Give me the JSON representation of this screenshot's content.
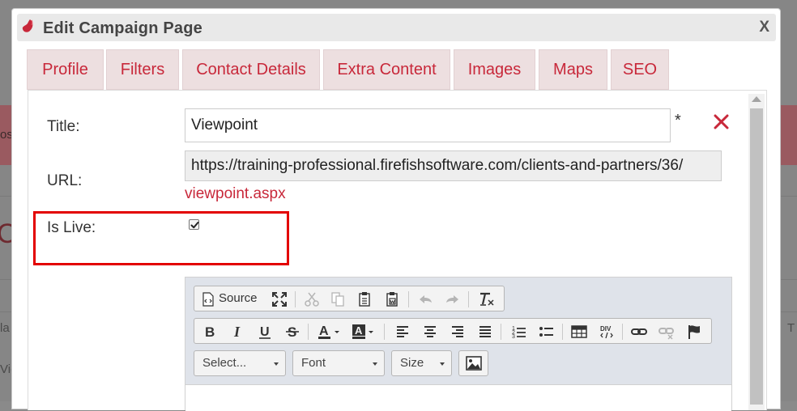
{
  "backdrop": {
    "fragment_left_1": "os",
    "fragment_left_2": "C",
    "fragment_left_3": "la",
    "fragment_left_4": "Vie",
    "fragment_right": "T"
  },
  "dialog": {
    "title": "Edit Campaign Page",
    "close_label": "X"
  },
  "tabs": [
    {
      "label": "Profile"
    },
    {
      "label": "Filters"
    },
    {
      "label": "Contact Details"
    },
    {
      "label": "Extra Content"
    },
    {
      "label": "Images"
    },
    {
      "label": "Maps"
    },
    {
      "label": "SEO"
    }
  ],
  "form": {
    "title_label": "Title:",
    "title_value": "Viewpoint",
    "required_marker": "*",
    "url_label": "URL:",
    "url_value": "https://training-professional.firefishsoftware.com/clients-and-partners/36/",
    "url_link": "viewpoint.aspx",
    "is_live_label": "Is Live:",
    "is_live_checked": true
  },
  "editor": {
    "source_label": "Source",
    "format_select": "Select...",
    "font_select": "Font",
    "size_select": "Size"
  },
  "colors": {
    "brand_red": "#c8283a",
    "highlight_red": "#e30000",
    "tab_bg": "#eddfe0"
  }
}
